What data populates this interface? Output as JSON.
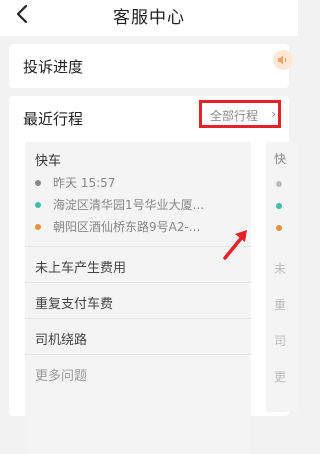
{
  "header": {
    "title": "客服中心",
    "back_icon": "chevron-left-icon"
  },
  "complaint": {
    "label": "投诉进度",
    "speaker_icon": "speaker-icon"
  },
  "recent_trips": {
    "label": "最近行程",
    "all_trips_link": "全部行程",
    "chevron": "›",
    "trip": {
      "type": "快车",
      "time": "昨天 15:57",
      "from": "海淀区清华园1号华业大厦...",
      "to": "朝阳区酒仙桥东路9号A2-..."
    },
    "issues": [
      "未上车产生费用",
      "重复支付车费",
      "司机绕路",
      "更多问题"
    ],
    "next_trip_peek": {
      "type": "快",
      "issue_chars": [
        "未",
        "重",
        "司",
        "更"
      ]
    }
  },
  "colors": {
    "highlight_box": "#e8202a",
    "from_dot": "#3dbfa8",
    "to_dot": "#f28c3c",
    "time_dot": "#888888"
  }
}
